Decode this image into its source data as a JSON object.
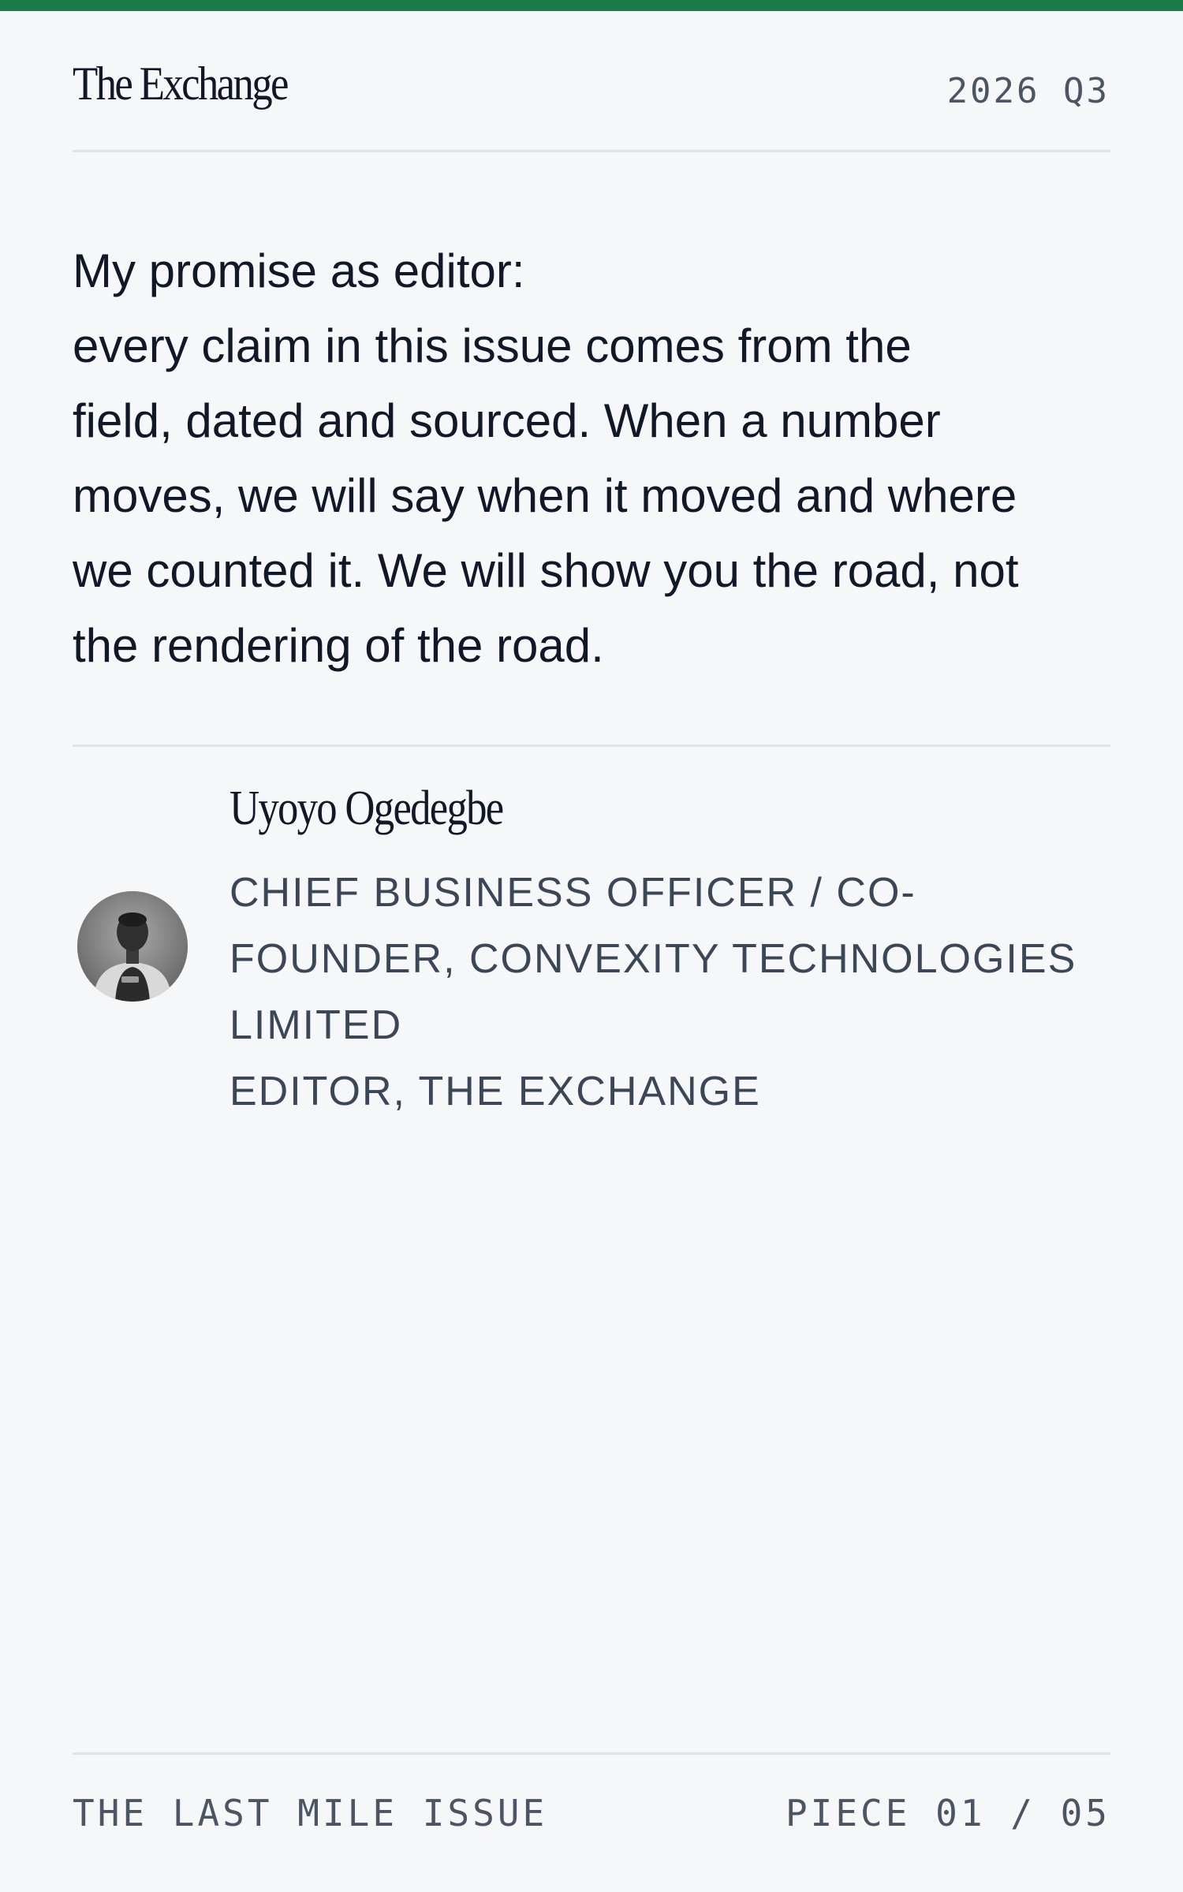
{
  "header": {
    "brand": "The Exchange",
    "issue_date": "2026 Q3"
  },
  "body": {
    "promise_lines": [
      "My promise as editor:",
      "every claim in this issue comes from the",
      "field, dated and sourced. When a number",
      "moves, we will say when it moved and where",
      "we counted it. We will show you the road, not",
      "the rendering of the road."
    ]
  },
  "author": {
    "name": "Uyoyo Ogedegbe",
    "role_lines": [
      "CHIEF BUSINESS OFFICER / CO-",
      "FOUNDER, CONVEXITY TECHNOLOGIES",
      "LIMITED",
      "EDITOR, THE EXCHANGE"
    ],
    "avatar_icon": "person-photo-icon"
  },
  "footer": {
    "issue_name": "THE LAST MILE ISSUE",
    "piece_counter": "PIECE 01 / 05"
  },
  "colors": {
    "accent": "#1c7a49",
    "background": "#f5f7f9",
    "text": "#111827",
    "muted": "#4b5563",
    "rule": "#dfe3e8"
  }
}
